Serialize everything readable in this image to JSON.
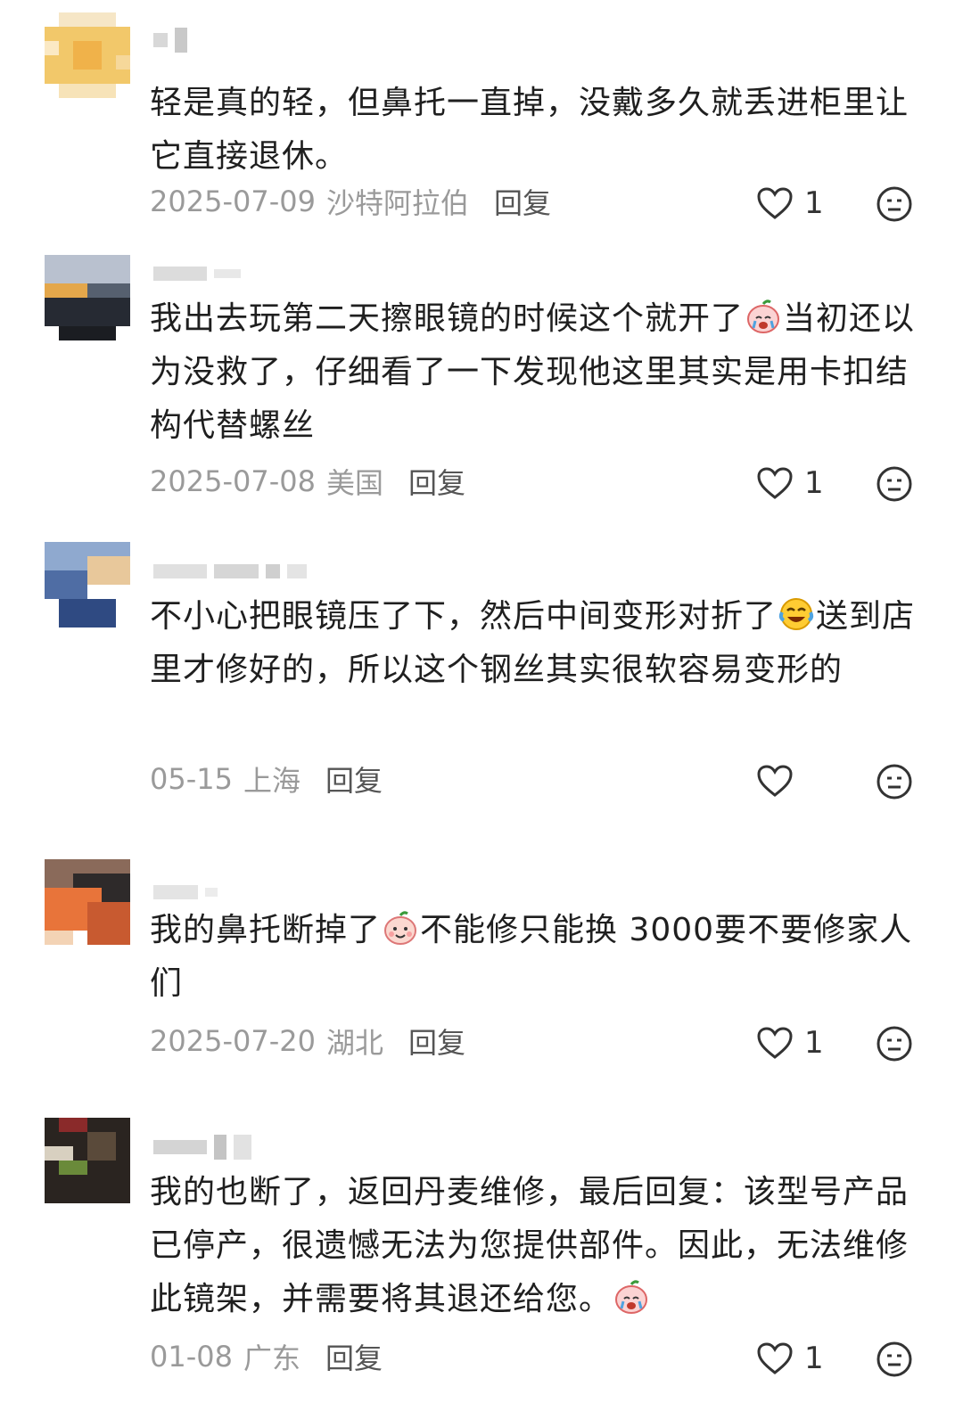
{
  "comments": [
    {
      "text": "轻是真的轻，但鼻托一直掉，没戴多久就丢进柜里让它直接退休。",
      "date": "2025-07-09",
      "location": "沙特阿拉伯",
      "reply": "回复",
      "likes": "1",
      "emojis": []
    },
    {
      "text_parts": [
        "我出去玩第二天擦眼镜的时候这个就开了",
        "当初还以为没救了，仔细看了一下发现他这里其实是用卡扣结构代替螺丝"
      ],
      "date": "2025-07-08",
      "location": "美国",
      "reply": "回复",
      "likes": "1",
      "emojis": [
        "crying-peach-emoji"
      ]
    },
    {
      "text_parts": [
        "不小心把眼镜压了下，然后中间变形对折了",
        "送到店里才修好的，所以这个钢丝其实很软容易变形的"
      ],
      "date": "05-15",
      "location": "上海",
      "reply": "回复",
      "likes": "",
      "emojis": [
        "laughing-tears-emoji"
      ]
    },
    {
      "text_parts": [
        "我的鼻托断掉了",
        "不能修只能换 3000要不要修家人们"
      ],
      "date": "2025-07-20",
      "location": "湖北",
      "reply": "回复",
      "likes": "1",
      "emojis": [
        "smiling-peach-emoji"
      ]
    },
    {
      "text_parts": [
        "我的也断了，返回丹麦维修，最后回复：该型号产品已停产，很遗憾无法为您提供部件。因此，无法维修此镜架，并需要将其退还给您。",
        ""
      ],
      "date": "01-08",
      "location": "广东",
      "reply": "回复",
      "likes": "1",
      "emojis": [
        "crying-peach-emoji"
      ]
    }
  ],
  "colors": {
    "text": "#1f1f1f",
    "meta": "#9a9a9a",
    "reply": "#555555",
    "icon": "#333333"
  },
  "icons": [
    "heart-icon",
    "emoji-reaction-icon"
  ]
}
